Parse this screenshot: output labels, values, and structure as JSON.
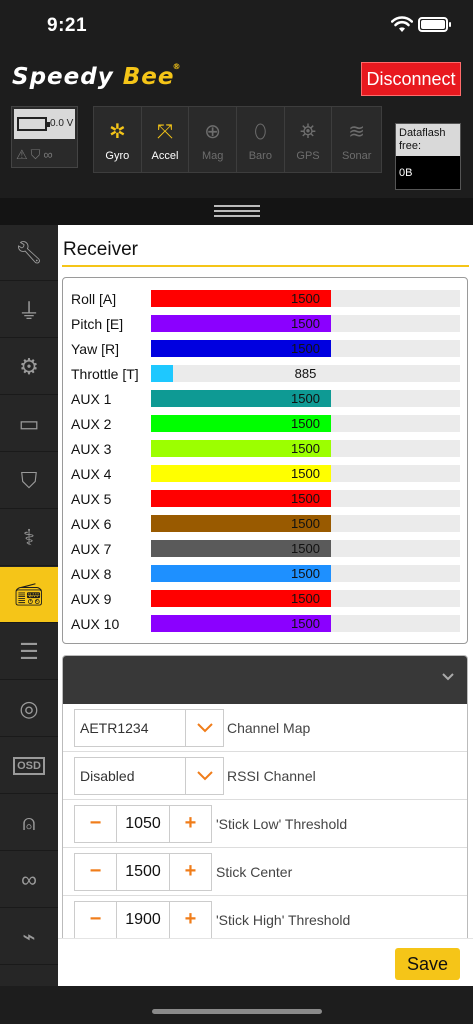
{
  "status_bar": {
    "time": "9:21"
  },
  "header": {
    "logo_word1": "Speedy",
    "logo_word2": "Bee",
    "logo_mark": "®",
    "disconnect_label": "Disconnect"
  },
  "battery": {
    "voltage": "0.0 V"
  },
  "sensors": [
    {
      "label": "Gyro",
      "icon": "gyro-icon",
      "active": true
    },
    {
      "label": "Accel",
      "icon": "accel-icon",
      "active": true
    },
    {
      "label": "Mag",
      "icon": "compass-icon",
      "active": false
    },
    {
      "label": "Baro",
      "icon": "thermometer-icon",
      "active": false
    },
    {
      "label": "GPS",
      "icon": "satellite-icon",
      "active": false
    },
    {
      "label": "Sonar",
      "icon": "sonar-icon",
      "active": false
    }
  ],
  "dataflash": {
    "label": "Dataflash free:",
    "value": "0B"
  },
  "sidebar": {
    "items": [
      {
        "name": "setup",
        "icon": "wrench-icon"
      },
      {
        "name": "ports",
        "icon": "plug-icon"
      },
      {
        "name": "configuration",
        "icon": "gear-icon"
      },
      {
        "name": "power",
        "icon": "battery-charge-icon"
      },
      {
        "name": "failsafe",
        "icon": "parachute-icon"
      },
      {
        "name": "pid-tuning",
        "icon": "hierarchy-icon"
      },
      {
        "name": "receiver",
        "icon": "radio-icon",
        "active": true
      },
      {
        "name": "modes",
        "icon": "toggle-icon"
      },
      {
        "name": "motors",
        "icon": "motor-icon"
      },
      {
        "name": "osd",
        "icon": "osd-icon",
        "text": "OSD"
      },
      {
        "name": "led-strip",
        "icon": "led-icon"
      },
      {
        "name": "blackbox",
        "icon": "infinity-icon"
      },
      {
        "name": "cli",
        "icon": "flash-icon"
      }
    ]
  },
  "receiver": {
    "title": "Receiver",
    "max_value": 2000,
    "min_value": 800,
    "channels": [
      {
        "label": "Roll [A]",
        "value": 1500,
        "color": "#ff0000"
      },
      {
        "label": "Pitch [E]",
        "value": 1500,
        "color": "#8b00ff"
      },
      {
        "label": "Yaw [R]",
        "value": 1500,
        "color": "#0000e0"
      },
      {
        "label": "Throttle [T]",
        "value": 885,
        "color": "#1ec8ff"
      },
      {
        "label": "AUX 1",
        "value": 1500,
        "color": "#0e9a94"
      },
      {
        "label": "AUX 2",
        "value": 1500,
        "color": "#00ff00"
      },
      {
        "label": "AUX 3",
        "value": 1500,
        "color": "#9cff00"
      },
      {
        "label": "AUX 4",
        "value": 1500,
        "color": "#ffff00"
      },
      {
        "label": "AUX 5",
        "value": 1500,
        "color": "#ff0000"
      },
      {
        "label": "AUX 6",
        "value": 1500,
        "color": "#995a00"
      },
      {
        "label": "AUX 7",
        "value": 1500,
        "color": "#5a5a5a"
      },
      {
        "label": "AUX 8",
        "value": 1500,
        "color": "#1e90ff"
      },
      {
        "label": "AUX 9",
        "value": 1500,
        "color": "#ff0000"
      },
      {
        "label": "AUX 10",
        "value": 1500,
        "color": "#8b00ff"
      }
    ]
  },
  "settings": {
    "channel_map": {
      "value": "AETR1234",
      "label": "Channel Map"
    },
    "rssi_channel": {
      "value": "Disabled",
      "label": "RSSI Channel"
    },
    "stick_low": {
      "value": "1050",
      "label": "'Stick Low' Threshold"
    },
    "stick_center": {
      "value": "1500",
      "label": "Stick Center"
    },
    "stick_high": {
      "value": "1900",
      "label": "'Stick High' Threshold"
    },
    "minus": "−",
    "plus": "+"
  },
  "save_label": "Save",
  "colors": {
    "accent": "#f5c518",
    "danger": "#e8191f",
    "stepper": "#f07d1a"
  }
}
